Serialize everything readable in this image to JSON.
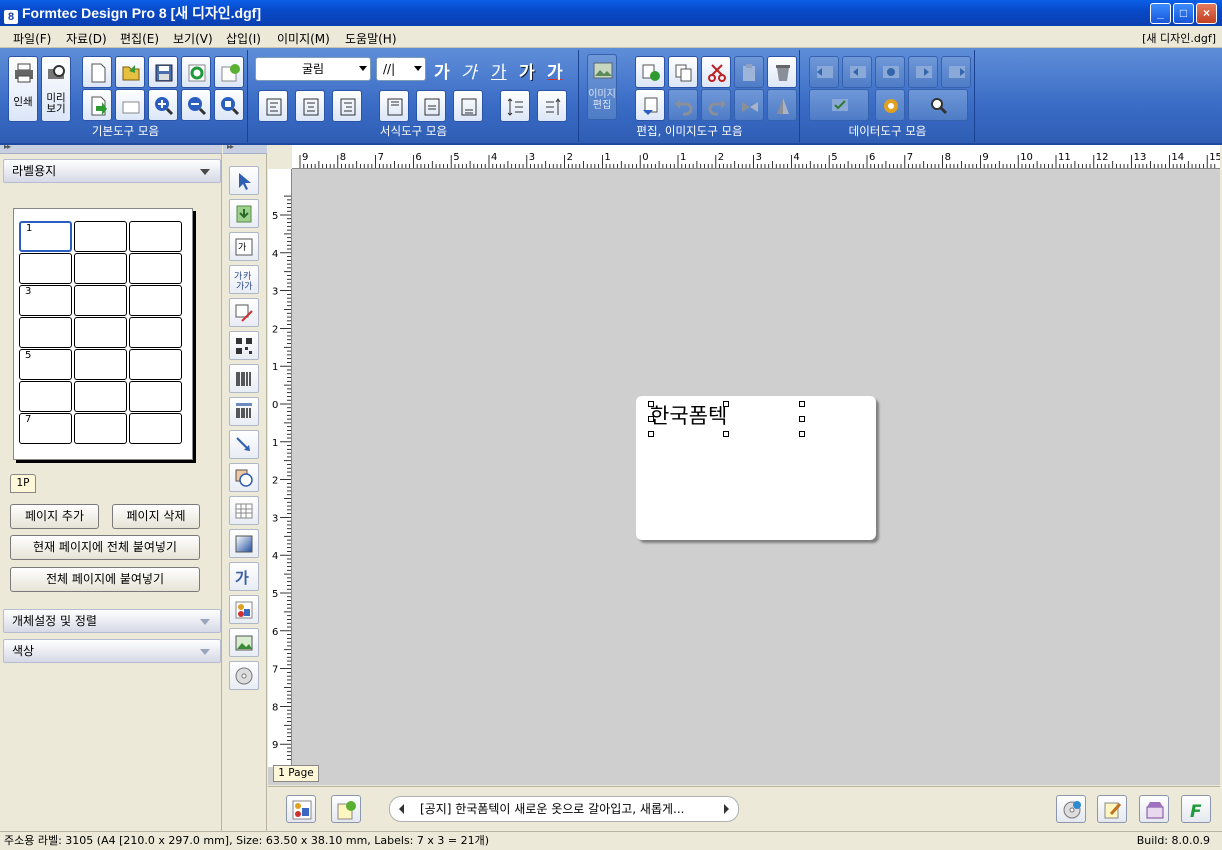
{
  "window": {
    "title": "Formtec Design Pro 8 [새 디자인.dgf]",
    "app_icon": "8",
    "controls": [
      "_",
      "□",
      "×"
    ]
  },
  "menu": {
    "items": [
      "파일(F)",
      "자료(D)",
      "편집(E)",
      "보기(V)",
      "삽입(I)",
      "이미지(M)",
      "도움말(H)"
    ],
    "doc_name": "[새 디자인.dgf]"
  },
  "toolbar": {
    "groups": {
      "basic": "기본도구 모음",
      "format": "서식도구 모음",
      "edit_image": "편집, 이미지도구 모음",
      "data": "데이터도구 모음"
    },
    "print_label": "인쇄",
    "preview_label": "미리\n보기",
    "image_edit_label": "이미지\n편집",
    "font_select": "굴림",
    "size_select": "//|",
    "text_style_glyphs": [
      "가",
      "가",
      "가",
      "가",
      "가"
    ]
  },
  "left_panel": {
    "label_paper_title": "라벨용지",
    "page_tab": "1P",
    "cell_numbers": [
      "1",
      "3",
      "5",
      "7"
    ],
    "buttons": {
      "add_page": "페이지 추가",
      "delete_page": "페이지 삭제",
      "paste_all_current": "현재 페이지에 전체 붙여넣기",
      "paste_all_pages": "전체 페이지에 붙여넣기"
    },
    "object_settings": "개체설정 및 정렬",
    "color": "색상"
  },
  "canvas": {
    "label_text": "한국폼텍",
    "page_tab": "1 Page",
    "h_ruler_numbers": [
      "9",
      "8",
      "7",
      "6",
      "5",
      "4",
      "3",
      "2",
      "1",
      "0",
      "1",
      "2",
      "3",
      "4",
      "5",
      "6",
      "7",
      "8",
      "9",
      "10",
      "11",
      "12",
      "13",
      "14",
      "15"
    ],
    "v_ruler_numbers": [
      "5",
      "4",
      "3",
      "2",
      "1",
      "0",
      "1",
      "2",
      "3",
      "4",
      "5",
      "6",
      "7",
      "8",
      "9"
    ]
  },
  "bottom": {
    "notice": "[공지] 한국폼텍이 새로운 옷으로 갈아입고, 새롭게..."
  },
  "status": {
    "info": "주소용 라벨: 3105 (A4 [210.0 x 297.0 mm], Size: 63.50 x 38.10 mm,  Labels: 7 x 3 = 21개)",
    "build": "Build: 8.0.0.9"
  }
}
